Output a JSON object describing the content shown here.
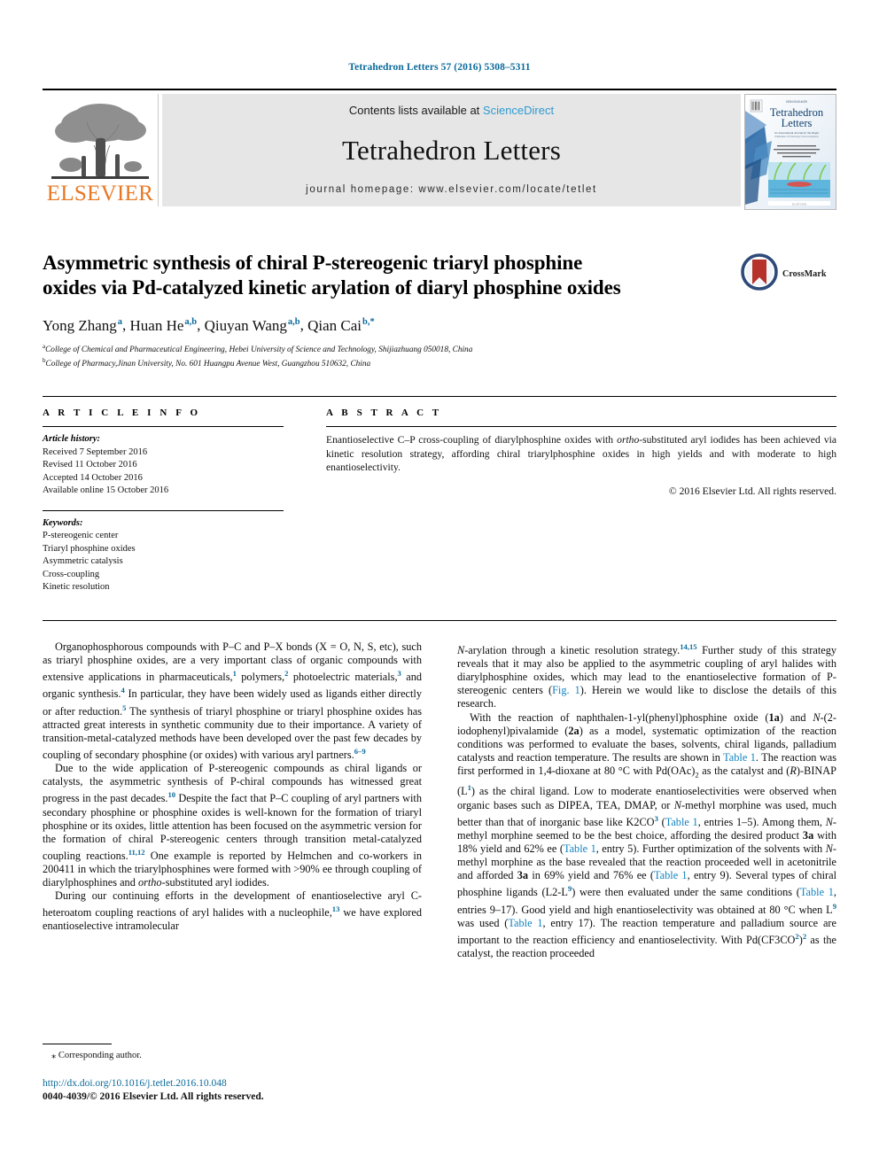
{
  "running_head": "Tetrahedron Letters 57 (2016) 5308–5311",
  "masthead": {
    "publisher_word": "ELSEVIER",
    "contents_prefix": "Contents lists available at ",
    "contents_link": "ScienceDirect",
    "journal_title": "Tetrahedron Letters",
    "homepage": "journal homepage: www.elsevier.com/locate/tetlet",
    "cover_title_line1": "Tetrahedron",
    "cover_title_line2": "Letters",
    "cover_top_label": "ISSN 0040-4039",
    "cover_sub_label": "An International Journal for the Rapid Publication of Preliminary Communications in Organic Chemistry",
    "cover_footer": "ELSEVIER"
  },
  "article": {
    "title_line1": "Asymmetric synthesis of chiral P-stereogenic triaryl phosphine",
    "title_line2": "oxides via Pd-catalyzed kinetic arylation of diaryl phosphine oxides",
    "crossmark_label": "CrossMark",
    "authors": [
      {
        "name": "Yong Zhang",
        "marks": "a",
        "sep": ", "
      },
      {
        "name": "Huan He",
        "marks": "a,b",
        "sep": ", "
      },
      {
        "name": "Qiuyan Wang",
        "marks": "a,b",
        "sep": ", "
      },
      {
        "name": "Qian Cai",
        "marks": "b,*",
        "sep": ""
      }
    ],
    "affiliations": [
      {
        "mark": "a",
        "text": "College of Chemical and Pharmaceutical Engineering, Hebei University of Science and Technology, Shijiazhuang 050018, China"
      },
      {
        "mark": "b",
        "text": "College of Pharmacy,Jinan University, No. 601 Huangpu Avenue West, Guangzhou 510632, China"
      }
    ]
  },
  "article_info": {
    "heading": "A R T I C L E  I N F O",
    "history_label": "Article history:",
    "history": [
      "Received 7 September 2016",
      "Revised 11 October 2016",
      "Accepted 14 October 2016",
      "Available online 15 October 2016"
    ],
    "keywords_label": "Keywords:",
    "keywords": [
      "P-stereogenic center",
      "Triaryl phosphine oxides",
      "Asymmetric catalysis",
      "Cross-coupling",
      "Kinetic resolution"
    ]
  },
  "abstract": {
    "heading": "A B S T R A C T",
    "text": "Enantioselective C–P cross-coupling of diarylphosphine oxides with ortho-substituted aryl iodides has been achieved via kinetic resolution strategy, affording chiral triarylphosphine oxides in high yields and with moderate to high enantioselectivity.",
    "italic_fragment": "ortho",
    "copyright": "© 2016 Elsevier Ltd. All rights reserved."
  },
  "body": {
    "left_paragraphs": [
      "Organophosphorous compounds with P–C and P–X bonds (X = O, N, S, etc), such as triaryl phosphine oxides, are a very important class of organic compounds with extensive applications in pharmaceuticals,1 polymers,2 photoelectric materials,3 and organic synthesis.4 In particular, they have been widely used as ligands either directly or after reduction.5 The synthesis of triaryl phosphine or triaryl phosphine oxides has attracted great interests in synthetic community due to their importance. A variety of transition-metal-catalyzed methods have been developed over the past few decades by coupling of secondary phosphine (or oxides) with various aryl partners.6–9",
      "Due to the wide application of P-stereogenic compounds as chiral ligands or catalysts, the asymmetric synthesis of P-chiral compounds has witnessed great progress in the past decades.10 Despite the fact that P–C coupling of aryl partners with secondary phosphine or phosphine oxides is well-known for the formation of triaryl phosphine or its oxides, little attention has been focused on the asymmetric version for the formation of chiral P-stereogenic centers through transition metal-catalyzed coupling reactions.11,12 One example is reported by Helmchen and co-workers in 200411 in which the triarylphosphines were formed with >90% ee through coupling of diarylphosphines and ortho-substituted aryl iodides.",
      "During our continuing efforts in the development of enantioselective aryl C-heteroatom coupling reactions of aryl halides with a nucleophile,13 we have explored enantioselective intramolecular"
    ],
    "right_paragraphs": [
      "N-arylation through a kinetic resolution strategy.14,15 Further study of this strategy reveals that it may also be applied to the asymmetric coupling of aryl halides with diarylphosphine oxides, which may lead to the enantioselective formation of P-stereogenic centers (Fig. 1). Herein we would like to disclose the details of this research.",
      "With the reaction of naphthalen-1-yl(phenyl)phosphine oxide (1a) and N-(2-iodophenyl)pivalamide (2a) as a model, systematic optimization of the reaction conditions was performed to evaluate the bases, solvents, chiral ligands, palladium catalysts and reaction temperature. The results are shown in Table 1. The reaction was first performed in 1,4-dioxane at 80 °C with Pd(OAc)2 as the catalyst and (R)-BINAP (L1) as the chiral ligand. Low to moderate enantioselectivities were observed when organic bases such as DIPEA, TEA, DMAP, or N-methyl morphine was used, much better than that of inorganic base like K2CO3 (Table 1, entries 1–5). Among them, N-methyl morphine seemed to be the best choice, affording the desired product 3a with 18% yield and 62% ee (Table 1, entry 5). Further optimization of the solvents with N-methyl morphine as the base revealed that the reaction proceeded well in acetonitrile and afforded 3a in 69% yield and 76% ee (Table 1, entry 9). Several types of chiral phosphine ligands (L2-L9) were then evaluated under the same conditions (Table 1, entries 9–17). Good yield and high enantioselectivity was obtained at 80 °C when L9 was used (Table 1, entry 17). The reaction temperature and palladium source are important to the reaction efficiency and enantioselectivity. With Pd(CF3CO2)2 as the catalyst, the reaction proceeded"
    ]
  },
  "footnote": {
    "marker": "⁎",
    "text": "Corresponding author."
  },
  "footer": {
    "doi": "http://dx.doi.org/10.1016/j.tetlet.2016.10.048",
    "issn": "0040-4039/© 2016 Elsevier Ltd. All rights reserved."
  },
  "colors": {
    "link_blue": "#1083c0",
    "head_blue": "#0b6a9a",
    "sciencedirect_blue": "#2e9ad0",
    "elsevier_orange": "#E87722",
    "band_gray": "#e6e6e6",
    "crossmark_red": "#b5312a"
  }
}
